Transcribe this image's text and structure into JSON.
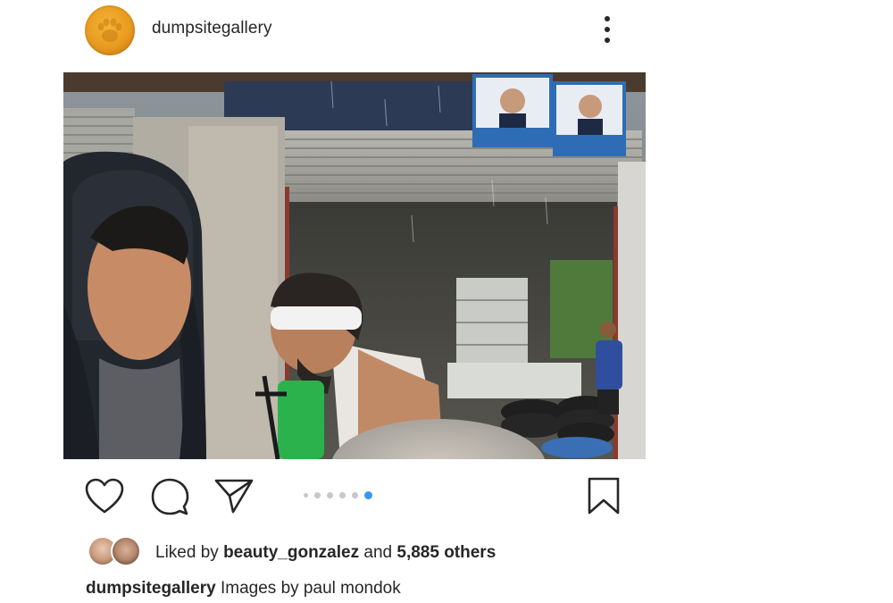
{
  "post": {
    "username": "dumpsitegallery",
    "more_icon": "more-vertical-icon",
    "photo_alt": "Image 5 of 5",
    "carousel": {
      "count": 5,
      "active_index": 4
    },
    "actions": {
      "like_icon": "heart-icon",
      "comment_icon": "comment-icon",
      "share_icon": "paper-plane-icon",
      "save_icon": "bookmark-icon"
    },
    "likes": {
      "prefix": "Liked by",
      "user": "beauty_gonzalez",
      "connector": "and",
      "others": "5,885 others"
    },
    "caption": {
      "user": "dumpsitegallery",
      "text": "Images by paul mondok"
    }
  },
  "colors": {
    "text": "#262626",
    "carousel_active": "#3897f0",
    "carousel_inactive": "#c7c7c7",
    "avatar": "#e79a1f"
  }
}
